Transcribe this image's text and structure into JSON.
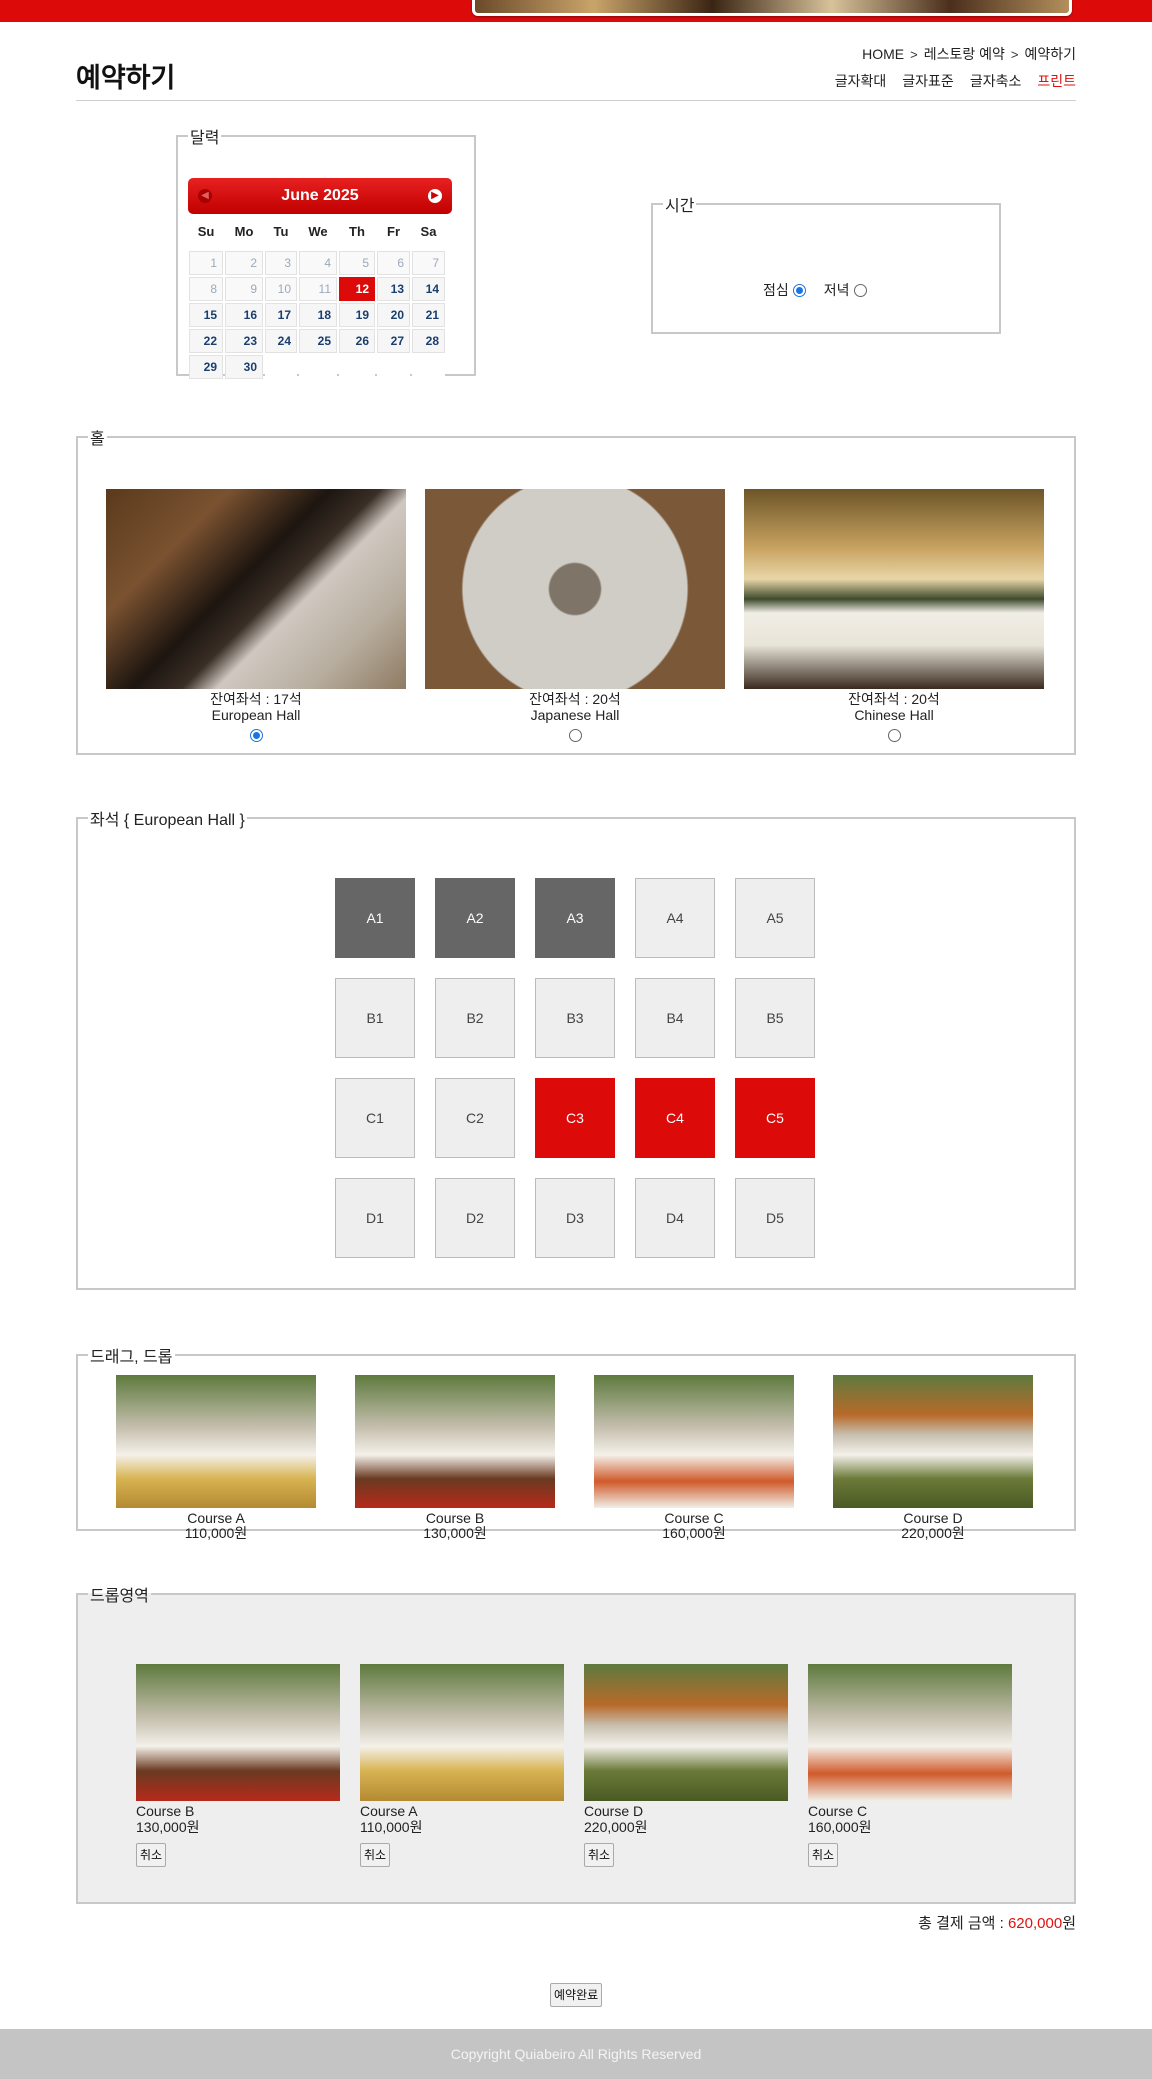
{
  "header": {
    "title": "예약하기",
    "breadcrumb": [
      "HOME",
      "레스토랑 예약",
      "예약하기"
    ],
    "tools": {
      "enlarge": "글자확대",
      "normal": "글자표준",
      "shrink": "글자축소",
      "print": "프린트"
    }
  },
  "calendar": {
    "legend": "달력",
    "month": "June 2025",
    "weekdays": [
      "Su",
      "Mo",
      "Tu",
      "We",
      "Th",
      "Fr",
      "Sa"
    ],
    "selected_day": 12
  },
  "time": {
    "legend": "시간",
    "options": [
      {
        "label": "점심",
        "checked": true
      },
      {
        "label": "저녁",
        "checked": false
      }
    ]
  },
  "hall": {
    "legend": "홀",
    "items": [
      {
        "remaining": "잔여좌석 : 17석",
        "name": "European Hall",
        "checked": true
      },
      {
        "remaining": "잔여좌석 : 20석",
        "name": "Japanese Hall",
        "checked": false
      },
      {
        "remaining": "잔여좌석 : 20석",
        "name": "Chinese Hall",
        "checked": false
      }
    ]
  },
  "seats": {
    "legend": "좌석 { European Hall }",
    "rows": [
      [
        {
          "id": "A1",
          "state": "taken"
        },
        {
          "id": "A2",
          "state": "taken"
        },
        {
          "id": "A3",
          "state": "taken"
        },
        {
          "id": "A4",
          "state": "free"
        },
        {
          "id": "A5",
          "state": "free"
        }
      ],
      [
        {
          "id": "B1",
          "state": "free"
        },
        {
          "id": "B2",
          "state": "free"
        },
        {
          "id": "B3",
          "state": "free"
        },
        {
          "id": "B4",
          "state": "free"
        },
        {
          "id": "B5",
          "state": "free"
        }
      ],
      [
        {
          "id": "C1",
          "state": "free"
        },
        {
          "id": "C2",
          "state": "free"
        },
        {
          "id": "C3",
          "state": "selected"
        },
        {
          "id": "C4",
          "state": "selected"
        },
        {
          "id": "C5",
          "state": "selected"
        }
      ],
      [
        {
          "id": "D1",
          "state": "free"
        },
        {
          "id": "D2",
          "state": "free"
        },
        {
          "id": "D3",
          "state": "free"
        },
        {
          "id": "D4",
          "state": "free"
        },
        {
          "id": "D5",
          "state": "free"
        }
      ]
    ]
  },
  "drag": {
    "legend": "드래그, 드롭",
    "courses": [
      {
        "name": "Course A",
        "price": "110,000원"
      },
      {
        "name": "Course B",
        "price": "130,000원"
      },
      {
        "name": "Course C",
        "price": "160,000원"
      },
      {
        "name": "Course D",
        "price": "220,000원"
      }
    ]
  },
  "drop": {
    "legend": "드롭영역",
    "cancel_label": "취소",
    "items": [
      {
        "name": "Course B",
        "price": "130,000원"
      },
      {
        "name": "Course A",
        "price": "110,000원"
      },
      {
        "name": "Course D",
        "price": "220,000원"
      },
      {
        "name": "Course C",
        "price": "160,000원"
      }
    ]
  },
  "total": {
    "label": "총 결제 금액 : ",
    "amount": "620,000",
    "unit": "원"
  },
  "submit_label": "예약완료",
  "footer": "Copyright Quiabeiro All Rights Reserved",
  "colors": {
    "accent": "#dd0a0a",
    "taken": "#666666",
    "free": "#eeeeee"
  }
}
